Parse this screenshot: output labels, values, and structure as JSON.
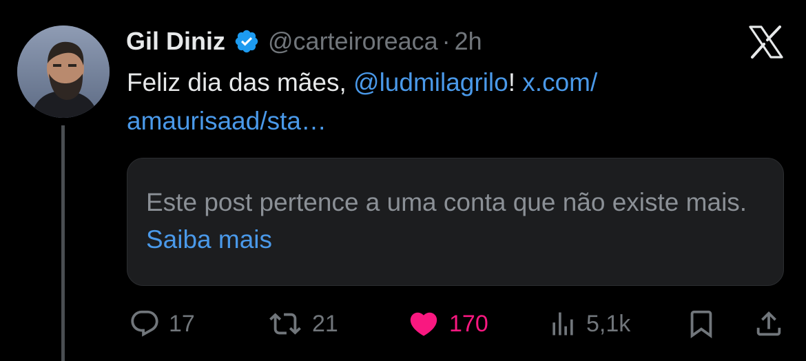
{
  "tweet": {
    "author_name": "Gil Diniz",
    "handle": "@carteiroreaca",
    "separator": "·",
    "time": "2h",
    "text_prefix": "Feliz dia das mães, ",
    "mention": "@ludmilagrilo",
    "text_exclaim": "!",
    "url_line1": "x.com/",
    "url_line2": "amaurisaad/sta…"
  },
  "quote": {
    "message": "Este post pertence a uma conta que não existe mais.",
    "link": "Saiba mais"
  },
  "actions": {
    "replies": "17",
    "reposts": "21",
    "likes": "170",
    "views": "5,1k"
  },
  "colors": {
    "background": "#000000",
    "link": "#4a99e9",
    "like": "#f91880",
    "muted": "#71767b",
    "verified": "#1d9bf0"
  },
  "icons": [
    "verified-badge-icon",
    "x-logo-icon",
    "reply-icon",
    "repost-icon",
    "heart-icon",
    "views-icon",
    "bookmark-icon",
    "share-icon"
  ]
}
